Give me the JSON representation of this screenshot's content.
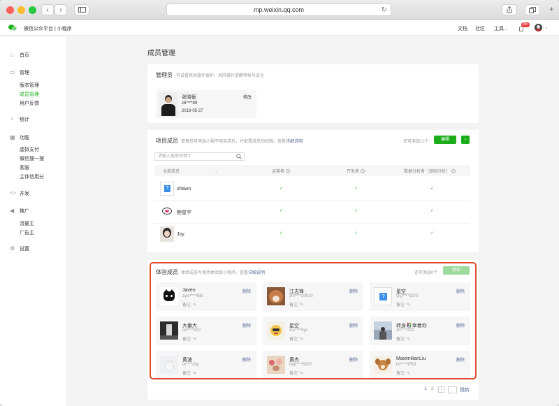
{
  "browser": {
    "url": "mp.weixin.qq.com"
  },
  "header": {
    "brand": "微信公众平台 | 小程序",
    "nav": [
      "文档",
      "社区",
      "工具"
    ],
    "badge": "99+"
  },
  "sidebar": {
    "home": "首页",
    "manage": {
      "label": "管理",
      "items": [
        "版本管理",
        "成员管理",
        "用户反馈"
      ]
    },
    "stats": "统计",
    "features": {
      "label": "功能",
      "items": [
        "虚拟支付",
        "微信搜一搜",
        "客服",
        "主体信用分"
      ]
    },
    "dev": "开发",
    "promo": {
      "label": "推广",
      "items": [
        "流量主",
        "广告主"
      ]
    },
    "settings": "设置"
  },
  "page": {
    "title": "成员管理"
  },
  "admin": {
    "title": "管理员",
    "desc": "可设置风险操作保护、风险操作提醒等帐号安全",
    "name": "张晓衡",
    "id": "z6****89",
    "date": "2019-05-27",
    "modify": "修改"
  },
  "project": {
    "title": "项目成员",
    "desc": "管理员可添加小程序项目成员，并配置成员的权限。查看",
    "desc_link": "详细说明",
    "remaining": "还可添加12个",
    "edit": "编辑",
    "search_placeholder": "请输入搜索关键字",
    "columns": [
      "全部成员",
      "运营者",
      "开发者",
      "数据分析者（基础分析）"
    ],
    "members": [
      {
        "name": "shawn"
      },
      {
        "name": "鲍星宇"
      },
      {
        "name": "Joy"
      }
    ],
    "check": "✓"
  },
  "testers": {
    "title": "体验成员",
    "desc": "体验成员可使用体验版小程序。查看",
    "desc_link": "详细说明",
    "remaining": "还可添加0个",
    "add": "添加",
    "note_label": "备注:",
    "delete": "删除",
    "list": [
      {
        "name": "Javen",
        "id": "zyw****485"
      },
      {
        "name": "江志锋",
        "id": "zhi****20510"
      },
      {
        "name": "星空",
        "id": "QQ****9375"
      },
      {
        "name": "大垂大",
        "id": "da****322"
      },
      {
        "name": "星空",
        "id": "sta****kys"
      },
      {
        "name": "转身👫幸着你",
        "id": "zh****222"
      },
      {
        "name": "黄波",
        "id": "te****city"
      },
      {
        "name": "黄杰",
        "id": "heji****8025"
      },
      {
        "name": "MaximilianLiu",
        "id": "lzl****3763"
      }
    ]
  },
  "pagination": {
    "p1": "1",
    "p2": "2",
    "next": "›",
    "jump": "跳转"
  }
}
